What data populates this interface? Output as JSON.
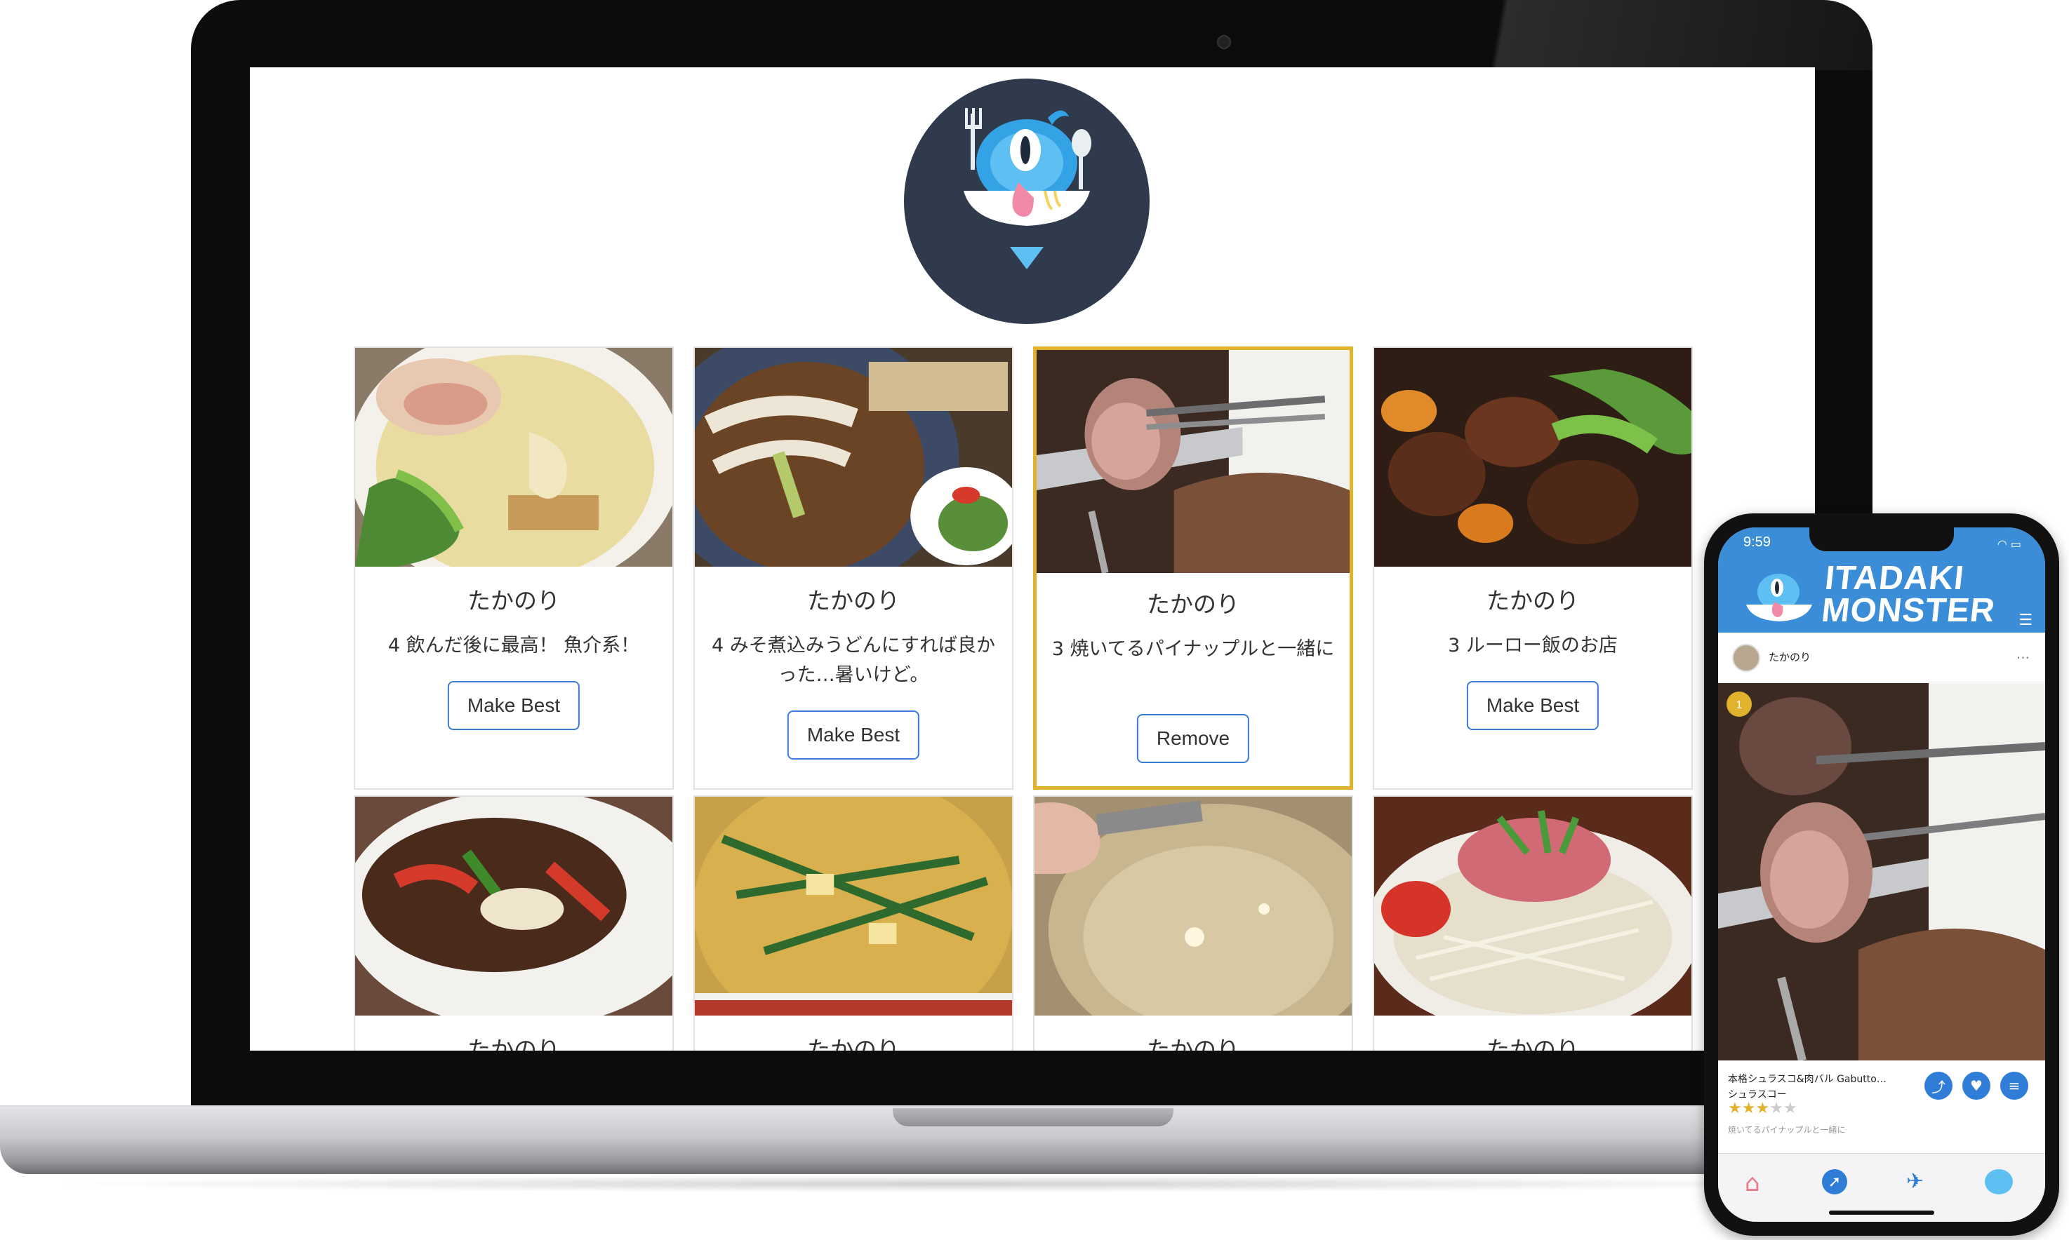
{
  "site": {
    "logo_name": "monster-logo"
  },
  "cards": [
    {
      "author": "たかのり",
      "comment": "4 飲んだ後に最高！ 魚介系！",
      "button": "Make Best"
    },
    {
      "author": "たかのり",
      "comment": "4 みそ煮込みうどんにすれば良かった…暑いけど。",
      "button": "Make Best"
    },
    {
      "author": "たかのり",
      "comment": "3 焼いてるパイナップルと一緒に",
      "button": "Remove"
    },
    {
      "author": "たかのり",
      "comment": "3 ルーロー飯のお店",
      "button": "Make Best"
    },
    {
      "author": "たかのり"
    },
    {
      "author": "たかのり"
    },
    {
      "author": "たかのり"
    },
    {
      "author": "たかのり"
    }
  ],
  "phone": {
    "time": "9:59",
    "brand_line1": "ITADAKI",
    "brand_line2": "MONSTER",
    "username": "たかのり",
    "more": "...",
    "restaurant": "本格シュラスコ&肉バル Gabutto…",
    "dish": "シュラスコー",
    "rating": 3,
    "rating_max": 5,
    "comment": "焼いてるパイナップルと一緒に",
    "colors": {
      "header": "#3b8dd8",
      "star": "#e1b22c",
      "action": "#2f7dd6"
    },
    "icons": [
      "home-icon",
      "compass-icon",
      "camera-icon",
      "monster-icon"
    ]
  },
  "colors": {
    "best_border": "#e1b22c",
    "button_border": "#3a7bd5"
  }
}
